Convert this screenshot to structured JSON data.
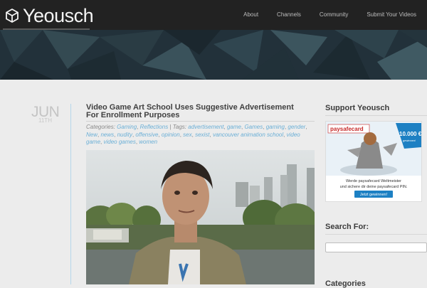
{
  "header": {
    "logo_text": "Yeousch",
    "nav": [
      "About",
      "Channels",
      "Community",
      "Submit Your Videos"
    ]
  },
  "post": {
    "month": "JUN",
    "day": "11TH",
    "title": "Video Game Art School Uses Suggestive Advertisement For Enrollment Purposes",
    "categories_label": "Categories:",
    "categories": [
      "Gaming",
      "Reflections"
    ],
    "tags_label": "Tags:",
    "tags": [
      "advertisement",
      "game",
      "Games",
      "gaming",
      "gender",
      "New",
      "news",
      "nudity",
      "offensive",
      "opinion",
      "sex",
      "sexist",
      "vancouver animation school",
      "video game",
      "video games",
      "women"
    ]
  },
  "sidebar": {
    "support_title": "Support Yeousch",
    "ad": {
      "brand": "paysafecard",
      "price_amount": "10.000 €",
      "price_sub": "gewinnen!",
      "line1": "Werde paysafecard Weltmeister",
      "line2": "und sichere dir deine paysafecard PIN.",
      "cta": "Jetzt gewinnen!"
    },
    "search_title": "Search For:",
    "search_value": "",
    "categories_title": "Categories"
  },
  "colors": {
    "topbar": "#222222",
    "link": "#6bafd6",
    "date": "#c4c4c4",
    "accent_line": "#b5d7ea",
    "ad_blue": "#1d80c3"
  }
}
